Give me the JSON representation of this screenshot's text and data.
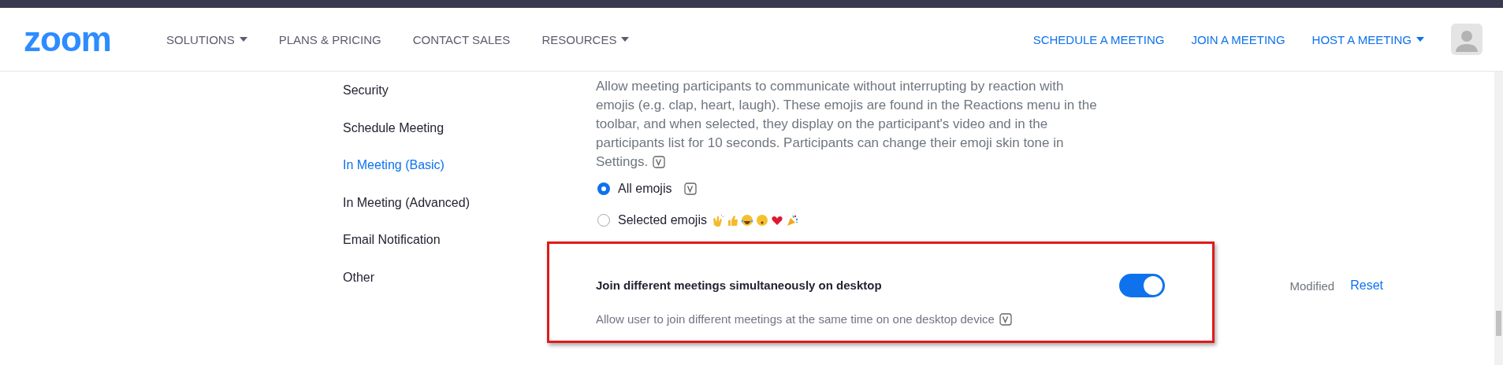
{
  "header": {
    "logo": "zoom",
    "nav": [
      {
        "label": "SOLUTIONS",
        "dropdown": true
      },
      {
        "label": "PLANS & PRICING",
        "dropdown": false
      },
      {
        "label": "CONTACT SALES",
        "dropdown": false
      },
      {
        "label": "RESOURCES",
        "dropdown": true
      }
    ],
    "actions": [
      {
        "label": "SCHEDULE A MEETING",
        "dropdown": false
      },
      {
        "label": "JOIN A MEETING",
        "dropdown": false
      },
      {
        "label": "HOST A MEETING",
        "dropdown": true
      }
    ]
  },
  "sidebar": {
    "items": [
      {
        "label": "Security",
        "selected": false
      },
      {
        "label": "Schedule Meeting",
        "selected": false
      },
      {
        "label": "In Meeting (Basic)",
        "selected": true
      },
      {
        "label": "In Meeting (Advanced)",
        "selected": false
      },
      {
        "label": "Email Notification",
        "selected": false
      },
      {
        "label": "Other",
        "selected": false
      }
    ]
  },
  "settings": [
    {
      "description": "Allow meeting participants to communicate without interrupting by reaction with emojis (e.g. clap, heart, laugh). These emojis are found in the Reactions menu in the toolbar, and when selected, they display on the participant's video and in the participants list for 10 seconds. Participants can change their emoji skin tone in Settings.",
      "version_badge": true,
      "options": [
        {
          "label": "All emojis",
          "selected": true,
          "version_badge": true,
          "emojis": false
        },
        {
          "label": "Selected emojis",
          "selected": false,
          "version_badge": false,
          "emojis": true
        }
      ]
    },
    {
      "title": "Join different meetings simultaneously on desktop",
      "on": true,
      "highlighted": true,
      "description": "Allow user to join different meetings at the same time on one desktop device",
      "version_badge": true,
      "status": "Modified",
      "action": "Reset"
    }
  ]
}
